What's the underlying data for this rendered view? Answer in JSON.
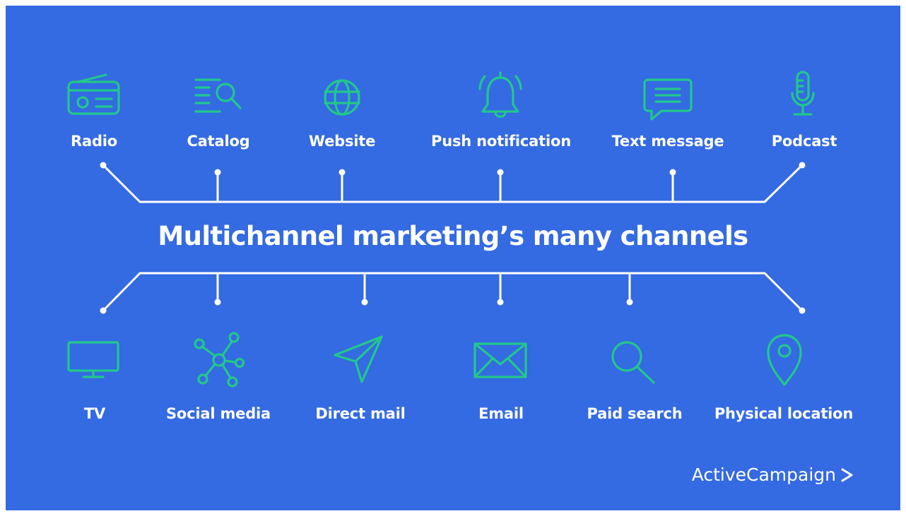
{
  "title": "Multichannel marketing’s many channels",
  "brand": "ActiveCampaign",
  "colors": {
    "background": "#346ae2",
    "icon": "#22c88b",
    "text": "#ffffff",
    "lines": "#ffffff"
  },
  "top_channels": [
    {
      "label": "Radio",
      "icon": "radio-icon"
    },
    {
      "label": "Catalog",
      "icon": "catalog-icon"
    },
    {
      "label": "Website",
      "icon": "globe-icon"
    },
    {
      "label": "Push notification",
      "icon": "bell-icon"
    },
    {
      "label": "Text message",
      "icon": "chat-bubble-icon"
    },
    {
      "label": "Podcast",
      "icon": "microphone-icon"
    }
  ],
  "bottom_channels": [
    {
      "label": "TV",
      "icon": "tv-icon"
    },
    {
      "label": "Social media",
      "icon": "network-icon"
    },
    {
      "label": "Direct mail",
      "icon": "paper-plane-icon"
    },
    {
      "label": "Email",
      "icon": "envelope-icon"
    },
    {
      "label": "Paid search",
      "icon": "magnifier-icon"
    },
    {
      "label": "Physical location",
      "icon": "map-pin-icon"
    }
  ]
}
